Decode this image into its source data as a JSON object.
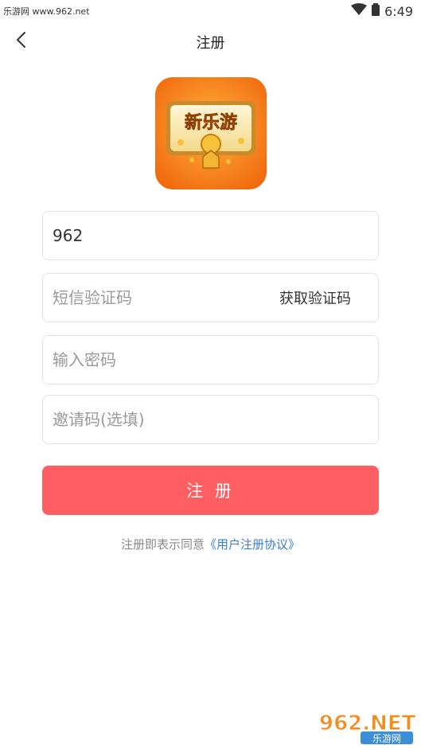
{
  "status_bar": {
    "site_label": "乐游网 www.962.net",
    "time": "6:49"
  },
  "header": {
    "title": "注册"
  },
  "logo": {
    "text": "新乐游"
  },
  "form": {
    "phone_value": "962",
    "sms_code_placeholder": "短信验证码",
    "get_code_label": "获取验证码",
    "password_placeholder": "输入密码",
    "invite_placeholder": "邀请码(选填)"
  },
  "submit": {
    "label": "注 册"
  },
  "agreement": {
    "text": "注册即表示同意",
    "link": "《用户注册协议》"
  },
  "watermark": {
    "brand": "962.NET",
    "subtitle": "乐游网"
  },
  "colors": {
    "primary_button": "#ff5e62",
    "link": "#3a7bd5",
    "logo_bg": "#f57a14"
  }
}
